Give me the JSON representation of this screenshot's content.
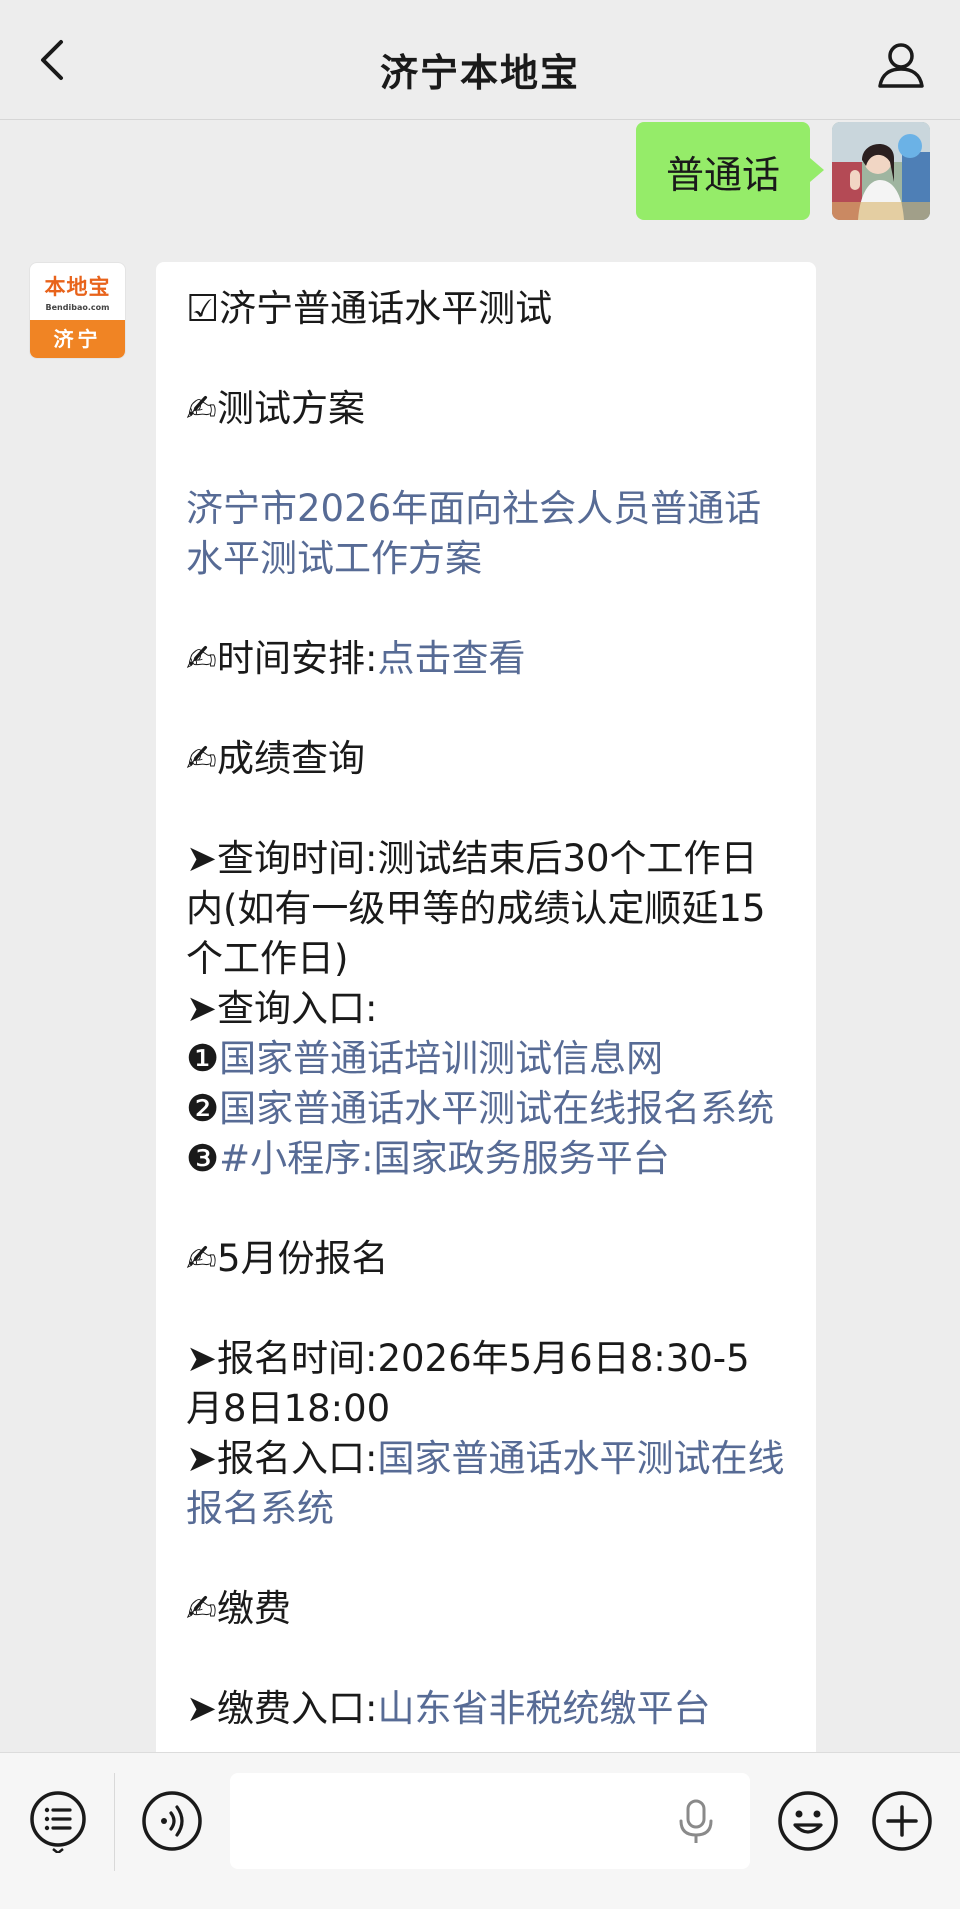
{
  "header": {
    "title": "济宁本地宝"
  },
  "chat": {
    "user_message": "普通话",
    "bot_avatar": {
      "logo_text": "本地宝",
      "logo_url": "Bendibao.com",
      "city": "济宁"
    },
    "reply": {
      "heading": "☑济宁普通话水平测试",
      "s1_title": "✍测试方案",
      "s1_link": "济宁市2026年面向社会人员普通话水平测试工作方案",
      "s2_prefix": "✍时间安排:",
      "s2_link": "点击查看",
      "s3_title": "✍成绩查询",
      "s3_query_time": "➤查询时间:测试结束后30个工作日内(如有一级甲等的成绩认定顺延15个工作日)",
      "s3_entry_label": "➤查询入口:",
      "s3_entry1_num": "❶",
      "s3_entry1_link": "国家普通话培训测试信息网",
      "s3_entry2_num": "❷",
      "s3_entry2_link": "国家普通话水平测试在线报名系统",
      "s3_entry3_num": "❸",
      "s3_entry3_link": "#小程序:国家政务服务平台",
      "s4_title": "✍5月份报名",
      "s4_time": "➤报名时间:2026年5月6日8:30-5月8日18:00",
      "s4_entry_prefix": "➤报名入口:",
      "s4_entry_link": "国家普通话水平测试在线报名系统",
      "s5_title": "✍缴费",
      "s5_entry_prefix": "➤缴费入口:",
      "s5_entry_link": "山东省非税统缴平台"
    }
  },
  "colors": {
    "link": "#576b95",
    "my_bubble": "#95ec69",
    "background": "#ededed",
    "logo_orange": "#f08424"
  },
  "icons": [
    "back-arrow-icon",
    "person-icon",
    "menu-list-icon",
    "voice-icon",
    "microphone-icon",
    "emoji-icon",
    "plus-icon"
  ]
}
